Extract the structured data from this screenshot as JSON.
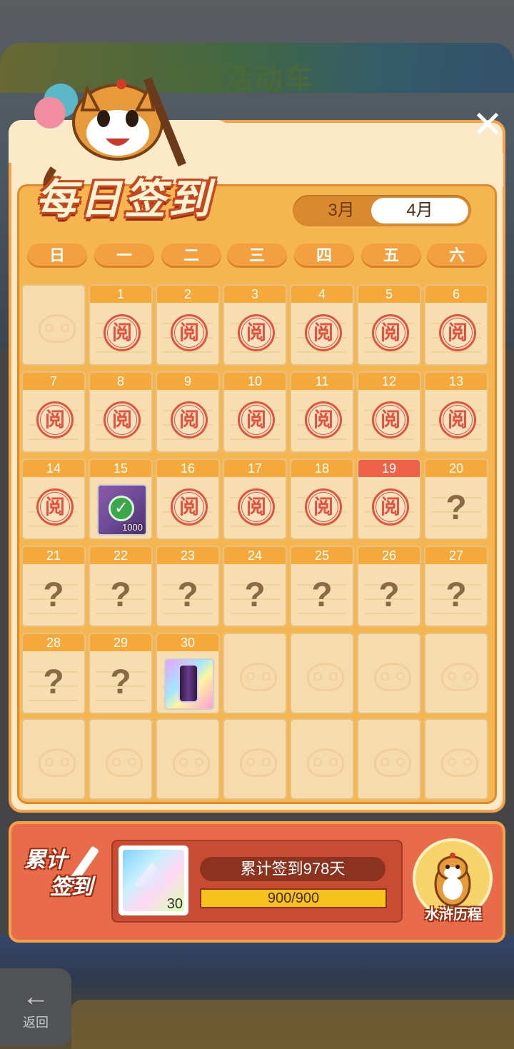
{
  "background": {
    "banner_text": "巡回活动车",
    "back_label": "返回"
  },
  "dialog": {
    "title": "每日签到",
    "close_label": "✕",
    "month_tabs": [
      {
        "label": "3月",
        "selected": false
      },
      {
        "label": "4月",
        "selected": true
      }
    ],
    "weekdays": [
      "日",
      "一",
      "二",
      "三",
      "四",
      "五",
      "六"
    ],
    "stamp_text": "阅",
    "unknown_text": "?",
    "today": 19,
    "days": [
      {
        "day": "1",
        "state": "signed"
      },
      {
        "day": "2",
        "state": "signed"
      },
      {
        "day": "3",
        "state": "signed"
      },
      {
        "day": "4",
        "state": "signed"
      },
      {
        "day": "5",
        "state": "signed"
      },
      {
        "day": "6",
        "state": "signed"
      },
      {
        "day": "7",
        "state": "signed"
      },
      {
        "day": "8",
        "state": "signed"
      },
      {
        "day": "9",
        "state": "signed"
      },
      {
        "day": "10",
        "state": "signed"
      },
      {
        "day": "11",
        "state": "signed"
      },
      {
        "day": "12",
        "state": "signed"
      },
      {
        "day": "13",
        "state": "signed"
      },
      {
        "day": "14",
        "state": "signed"
      },
      {
        "day": "15",
        "state": "reward-claimed",
        "amount": "1000"
      },
      {
        "day": "16",
        "state": "signed"
      },
      {
        "day": "17",
        "state": "signed"
      },
      {
        "day": "18",
        "state": "signed"
      },
      {
        "day": "19",
        "state": "signed"
      },
      {
        "day": "20",
        "state": "unknown"
      },
      {
        "day": "21",
        "state": "unknown"
      },
      {
        "day": "22",
        "state": "unknown"
      },
      {
        "day": "23",
        "state": "unknown"
      },
      {
        "day": "24",
        "state": "unknown"
      },
      {
        "day": "25",
        "state": "unknown"
      },
      {
        "day": "26",
        "state": "unknown"
      },
      {
        "day": "27",
        "state": "unknown"
      },
      {
        "day": "28",
        "state": "unknown"
      },
      {
        "day": "29",
        "state": "unknown"
      },
      {
        "day": "30",
        "state": "reward"
      }
    ],
    "cumulative": {
      "label_line1": "累计",
      "label_line2": "签到",
      "reward_count": "30",
      "total_text": "累计签到978天",
      "progress_text": "900/900",
      "progress_value": 1.0,
      "journey_label": "水浒历程"
    }
  },
  "colors": {
    "accent": "#f5a93a",
    "today": "#f0614a",
    "stamp": "#e2523f",
    "bottom_bg": "#e86b4a"
  }
}
